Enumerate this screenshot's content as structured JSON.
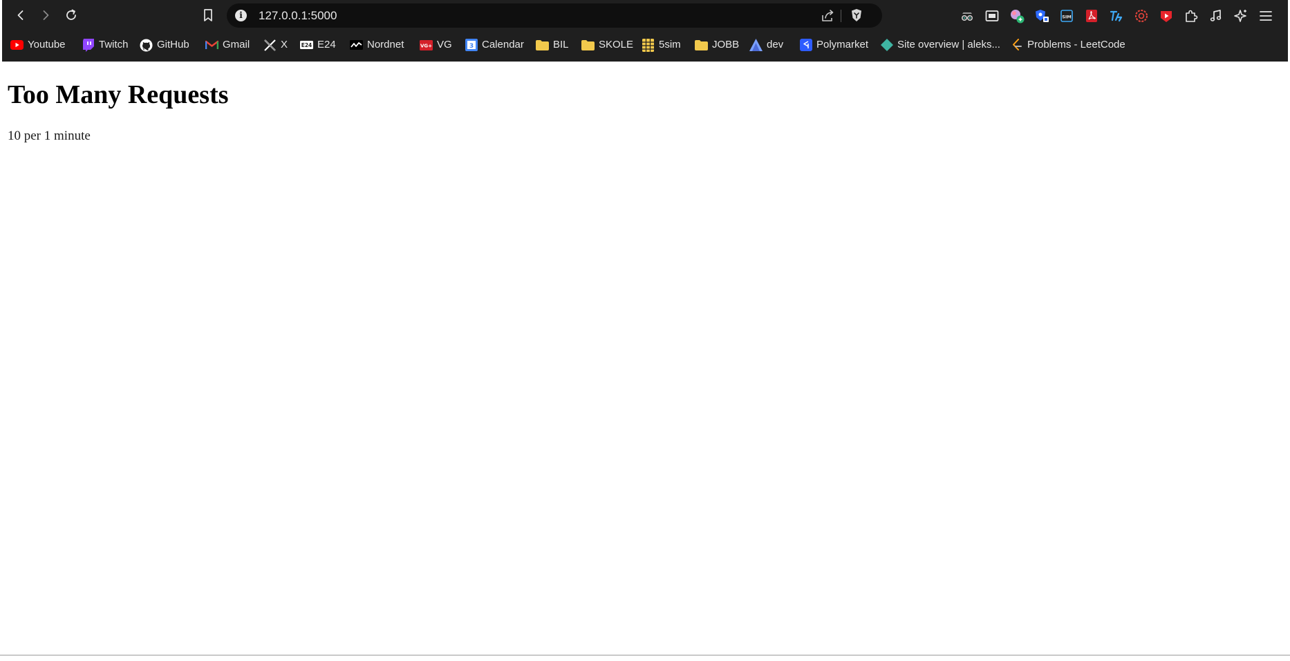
{
  "browser": {
    "address": "127.0.0.1:5000",
    "colors": {
      "chrome_bg": "#1f1f1f",
      "address_bg": "#0f0f0f",
      "text": "#e6e6e6"
    },
    "nav_icons": [
      "back-arrow-icon",
      "forward-arrow-icon",
      "reload-icon",
      "bookmark-icon"
    ],
    "extension_icons": [
      "incognito-glasses-icon",
      "picture-in-picture-icon",
      "color-picker-icon",
      "shield-extension-icon",
      "sim-icon",
      "pdf-icon",
      "translate-icon",
      "target-icon",
      "video-play-icon",
      "puzzle-icon",
      "music-note-icon",
      "sparkle-icon",
      "menu-icon"
    ]
  },
  "bookmarks": [
    {
      "label": "Youtube",
      "icon": "youtube-icon",
      "color": "#ff0000"
    },
    {
      "label": "Twitch",
      "icon": "twitch-icon",
      "color": "#9146ff"
    },
    {
      "label": "GitHub",
      "icon": "github-icon",
      "color": "#ffffff"
    },
    {
      "label": "Gmail",
      "icon": "gmail-icon",
      "color": "#ea4335"
    },
    {
      "label": "X",
      "icon": "x-icon",
      "color": "#ffffff"
    },
    {
      "label": "E24",
      "icon": "e24-icon",
      "color": "#ffffff"
    },
    {
      "label": "Nordnet",
      "icon": "nordnet-icon",
      "color": "#ffffff"
    },
    {
      "label": "VG",
      "icon": "vg-icon",
      "color": "#d4202a"
    },
    {
      "label": "Calendar",
      "icon": "calendar-icon",
      "color": "#4285f4"
    },
    {
      "label": "BIL",
      "icon": "folder-icon",
      "color": "#f2c94c"
    },
    {
      "label": "SKOLE",
      "icon": "folder-icon",
      "color": "#f2c94c"
    },
    {
      "label": "5sim",
      "icon": "grid-icon",
      "color": "#f2c94c"
    },
    {
      "label": "JOBB",
      "icon": "folder-icon",
      "color": "#f2c94c"
    },
    {
      "label": "dev",
      "icon": "dev-icon",
      "color": "#7aa0ff"
    },
    {
      "label": "Polymarket",
      "icon": "polymarket-icon",
      "color": "#2e5cff"
    },
    {
      "label": "Site overview | aleks...",
      "icon": "diamond-icon",
      "color": "#3fb5a3"
    },
    {
      "label": "Problems - LeetCode",
      "icon": "leetcode-icon",
      "color": "#ffa116"
    }
  ],
  "page": {
    "heading": "Too Many Requests",
    "message": "10 per 1 minute"
  }
}
